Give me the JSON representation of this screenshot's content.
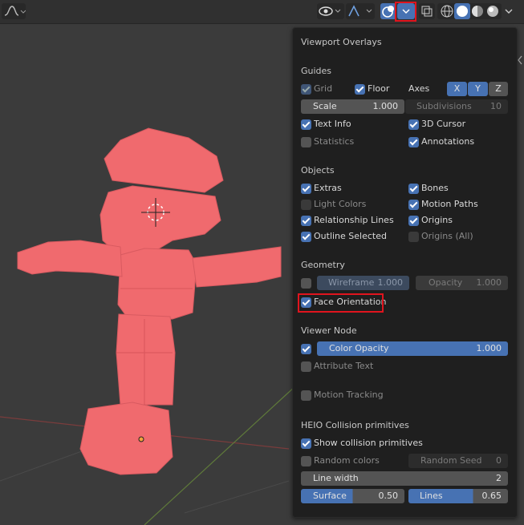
{
  "toolbar": {
    "overlay_dropdown": "chevron-down"
  },
  "overlays": {
    "title": "Viewport Overlays",
    "guides": {
      "header": "Guides",
      "grid": "Grid",
      "floor": "Floor",
      "axes": "Axes",
      "x": "X",
      "y": "Y",
      "z": "Z",
      "scale_label": "Scale",
      "scale_value": "1.000",
      "subdiv_label": "Subdivisions",
      "subdiv_value": "10",
      "text_info": "Text Info",
      "cursor": "3D Cursor",
      "statistics": "Statistics",
      "annotations": "Annotations"
    },
    "objects": {
      "header": "Objects",
      "extras": "Extras",
      "bones": "Bones",
      "light_colors": "Light Colors",
      "motion_paths": "Motion Paths",
      "relationship_lines": "Relationship Lines",
      "origins": "Origins",
      "outline_selected": "Outline Selected",
      "origins_all": "Origins (All)"
    },
    "geometry": {
      "header": "Geometry",
      "wireframe_label": "Wireframe",
      "wireframe_value": "1.000",
      "opacity_label": "Opacity",
      "opacity_value": "1.000",
      "face_orientation": "Face Orientation"
    },
    "viewer_node": {
      "header": "Viewer Node",
      "color_opacity_label": "Color Opacity",
      "color_opacity_value": "1.000",
      "attribute_text": "Attribute Text"
    },
    "motion_tracking": "Motion Tracking",
    "heio": {
      "header": "HEIO Collision primitives",
      "show": "Show collision primitives",
      "random_colors": "Random colors",
      "random_seed_label": "Random Seed",
      "random_seed_value": "0",
      "line_width_label": "Line width",
      "line_width_value": "2",
      "surface_label": "Surface",
      "surface_value": "0.50",
      "lines_label": "Lines",
      "lines_value": "0.65"
    }
  },
  "colors": {
    "accent": "#4772b3",
    "highlight": "#e0141e",
    "mesh": "#f06a6e"
  }
}
